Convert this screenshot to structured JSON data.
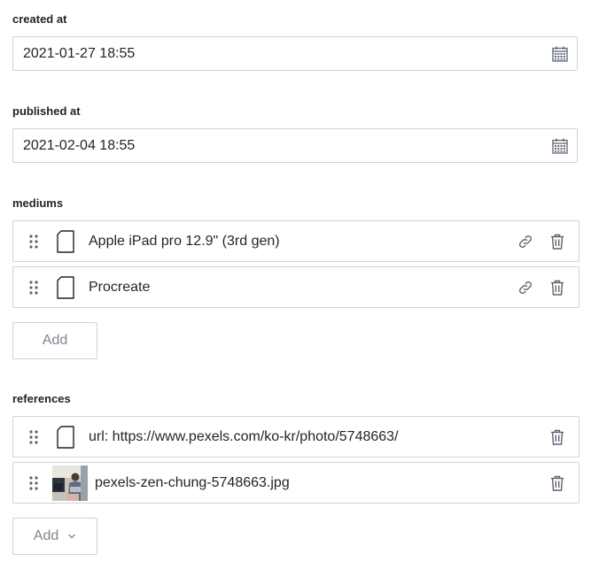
{
  "created_at": {
    "label": "created at",
    "value": "2021-01-27 18:55",
    "icon": "calendar-icon"
  },
  "published_at": {
    "label": "published at",
    "value": "2021-02-04 18:55",
    "icon": "calendar-icon"
  },
  "mediums": {
    "label": "mediums",
    "items": [
      {
        "title": "Apple iPad pro 12.9\" (3rd gen)"
      },
      {
        "title": "Procreate"
      }
    ],
    "add_label": "Add"
  },
  "references": {
    "label": "references",
    "items": [
      {
        "title": "url: https://www.pexels.com/ko-kr/photo/5748663/",
        "icon": "document-icon"
      },
      {
        "title": "pexels-zen-chung-5748663.jpg",
        "icon": "image-thumbnail"
      }
    ],
    "add_label": "Add"
  },
  "colors": {
    "border": "#cfd3d8",
    "text": "#1f2328",
    "muted": "#7d8791",
    "icon": "#5b6470"
  }
}
